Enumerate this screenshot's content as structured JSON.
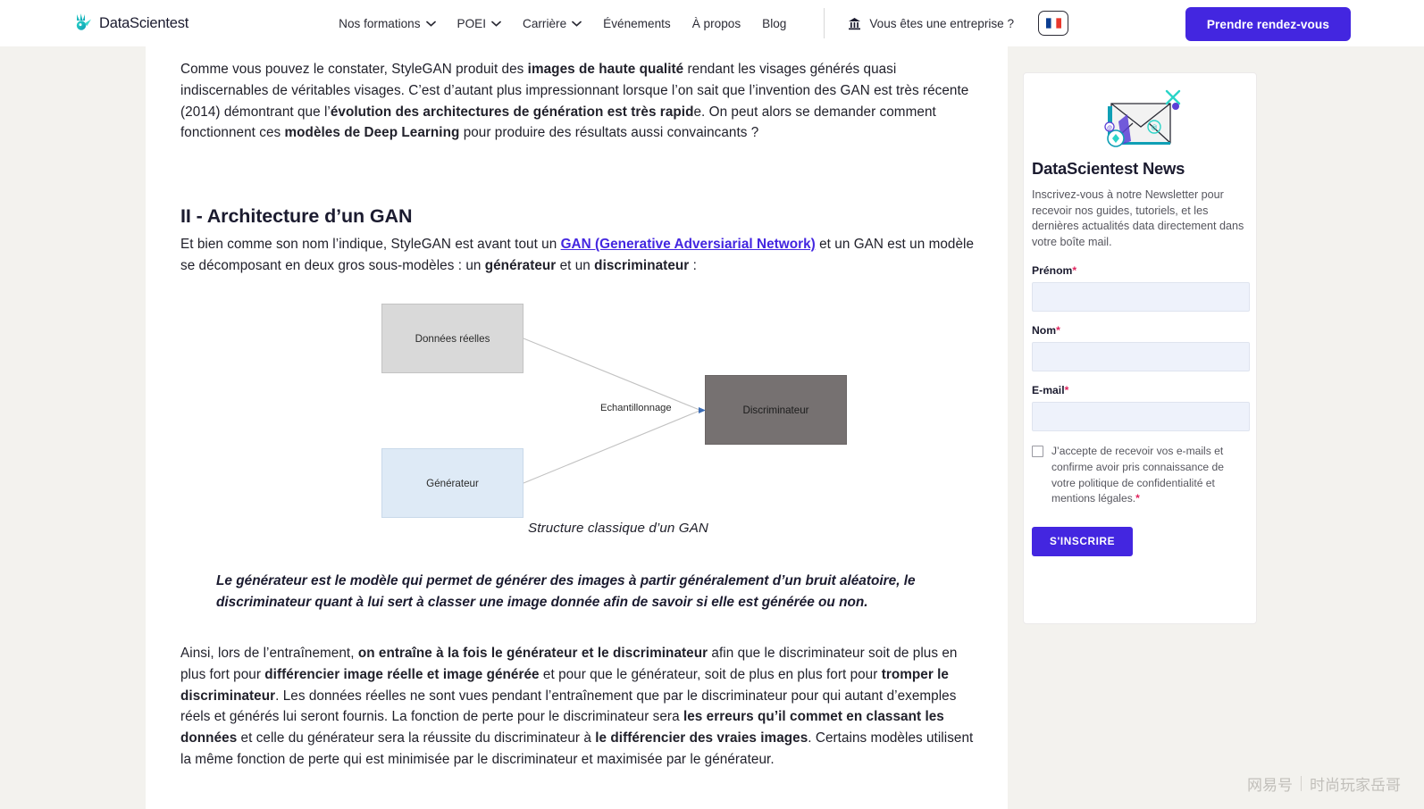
{
  "header": {
    "logo_text": "DataScientest",
    "nav": [
      {
        "label": "Nos formations",
        "has_chevron": true
      },
      {
        "label": "POEI",
        "has_chevron": true
      },
      {
        "label": "Carrière",
        "has_chevron": true
      },
      {
        "label": "Événements",
        "has_chevron": false
      },
      {
        "label": "À propos",
        "has_chevron": false
      },
      {
        "label": "Blog",
        "has_chevron": false
      }
    ],
    "enterprise_label": "Vous êtes une entreprise ?",
    "language": "FR",
    "cta_label": "Prendre rendez-vous",
    "accent_color": "#4326e0"
  },
  "article": {
    "intro": {
      "p1_a": "Comme vous pouvez le constater, StyleGAN produit des ",
      "p1_b1": "images de haute qualité",
      "p1_c": " rendant les visages générés quasi indiscernables de véritables visages. C’est d’autant plus impressionnant lorsque l’on sait que l’invention des GAN est très récente (2014) démontrant que l’",
      "p1_b2": "évolution des architectures de génération est très rapid",
      "p1_d": "e. On peut alors se demander comment fonctionnent ces ",
      "p1_b3": "modèles de Deep Learning",
      "p1_e": " pour produire des résultats aussi convaincants ?"
    },
    "section_title": "II - Architecture d’un GAN",
    "arch": {
      "a": "Et bien comme son nom l’indique, StyleGAN est avant tout un ",
      "link": "GAN (Generative Adversiarial Network)",
      "b": " et un GAN est un modèle se décomposant en deux gros sous-modèles : un ",
      "bold1": "générateur",
      "c": " et un ",
      "bold2": "discriminateur",
      "d": " :"
    },
    "quote": "Le générateur est le modèle qui permet de générer des images à partir généralement d’un bruit aléatoire, le discriminateur quant à lui sert à classer une image donnée afin de savoir si elle est générée ou non.",
    "closing": {
      "a": "Ainsi, lors de l’entraînement, ",
      "b1": "on entraîne à la fois le générateur et le discriminateur",
      "c": " afin que le discriminateur soit de plus en plus fort pour ",
      "b2": "différencier image réelle et image générée",
      "d": " et pour que le générateur, soit de plus en plus fort pour ",
      "b3": "tromper le discriminateur",
      "e": ". Les données réelles ne sont vues pendant l’entraînement que par le discriminateur pour qui autant d’exemples réels et générés lui seront fournis. La fonction de perte pour le discriminateur sera ",
      "b4": "les erreurs qu’il commet en classant les données",
      "f": " et celle du générateur sera la réussite du discriminateur à ",
      "b5": "le différencier des vraies images",
      "g": ". Certains modèles utilisent la même fonction de perte qui est minimisée par le discriminateur et maximisée par le générateur."
    }
  },
  "diagram": {
    "caption": "Structure classique d’un GAN",
    "nodes": [
      {
        "id": "real",
        "label": "Données réelles",
        "fill": "#d9d9d9"
      },
      {
        "id": "generator",
        "label": "Générateur",
        "fill": "#deeaf6"
      },
      {
        "id": "discriminator",
        "label": "Discriminateur",
        "fill": "#767171"
      }
    ],
    "edge_label": "Echantillonnage"
  },
  "sidebar": {
    "title": "DataScientest News",
    "description": "Inscrivez-vous à notre Newsletter pour recevoir nos guides, tutoriels, et les dernières actualités data directement dans votre boîte mail.",
    "fields": [
      {
        "label": "Prénom",
        "required": "*",
        "value": "",
        "placeholder": ""
      },
      {
        "label": "Nom",
        "required": "*",
        "value": "",
        "placeholder": ""
      },
      {
        "label": "E-mail",
        "required": "*",
        "value": "",
        "placeholder": ""
      }
    ],
    "consent": "J’accepte de recevoir vos e-mails et confirme avoir pris connaissance de votre politique de confidentialité et mentions légales.",
    "consent_required": "*",
    "submit_label": "S'INSCRIRE"
  },
  "watermark": {
    "brand": "网易号",
    "author": "时尚玩家岳哥"
  }
}
